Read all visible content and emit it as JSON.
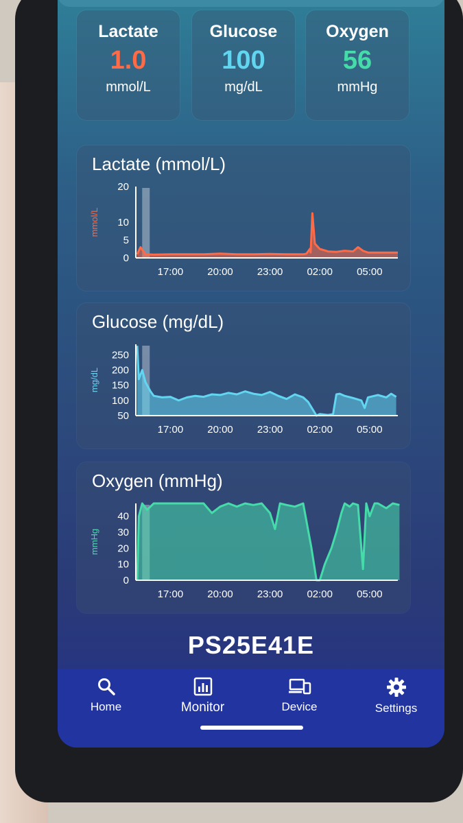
{
  "summary": [
    {
      "name": "Lactate",
      "value": "1.0",
      "unit": "mmol/L",
      "color": "#ff6a47"
    },
    {
      "name": "Glucose",
      "value": "100",
      "unit": "mg/dL",
      "color": "#62d6f0"
    },
    {
      "name": "Oxygen",
      "value": "56",
      "unit": "mmHg",
      "color": "#46dcaa"
    }
  ],
  "chart_data": [
    {
      "type": "area",
      "title": "Lactate (mmol/L)",
      "ylabel": "mmol/L",
      "ylim": [
        0,
        20
      ],
      "yticks": [
        "0",
        "5",
        "10",
        "20"
      ],
      "ytick_values": [
        0,
        5,
        10,
        20
      ],
      "xticks": [
        "17:00",
        "20:00",
        "23:00",
        "02:00",
        "05:00"
      ],
      "color": "#ff6a47",
      "label_color": "#ff6a47",
      "x_hours": [
        15.0,
        15.2,
        15.5,
        16.0,
        17.0,
        18.0,
        19.0,
        20.0,
        21.0,
        22.0,
        23.0,
        24.0,
        25.0,
        25.2,
        25.4,
        25.45,
        25.55,
        25.7,
        26.0,
        26.5,
        27.0,
        27.5,
        28.0,
        28.3,
        28.6,
        28.9,
        29.5,
        30.0,
        30.5,
        30.7
      ],
      "values": [
        1.0,
        3.0,
        1.0,
        0.9,
        1.0,
        1.0,
        1.0,
        1.2,
        1.0,
        1.0,
        1.1,
        1.0,
        1.0,
        1.2,
        2.5,
        1.5,
        12.5,
        4.0,
        2.5,
        1.8,
        1.7,
        2.0,
        1.8,
        3.0,
        2.0,
        1.5,
        1.5,
        1.5,
        1.5,
        1.5
      ]
    },
    {
      "type": "area",
      "title": "Glucose (mg/dL)",
      "ylabel": "mg/dL",
      "ylim": [
        50,
        285
      ],
      "yticks": [
        "50",
        "100",
        "150",
        "200",
        "250"
      ],
      "ytick_values": [
        50,
        100,
        150,
        200,
        250
      ],
      "xticks": [
        "17:00",
        "20:00",
        "23:00",
        "02:00",
        "05:00"
      ],
      "color": "#62d6f0",
      "label_color": "#62d6f0",
      "x_hours": [
        15.0,
        15.1,
        15.3,
        15.5,
        15.8,
        16.0,
        16.5,
        17.0,
        17.5,
        18.0,
        18.5,
        19.0,
        19.5,
        20.0,
        20.5,
        21.0,
        21.5,
        22.0,
        22.5,
        23.0,
        23.5,
        24.0,
        24.5,
        25.0,
        25.3,
        25.8,
        26.0,
        26.5,
        26.8,
        27.0,
        27.2,
        27.5,
        28.0,
        28.5,
        28.7,
        28.9,
        29.5,
        30.0,
        30.3,
        30.6
      ],
      "values": [
        280,
        170,
        200,
        160,
        130,
        115,
        110,
        112,
        100,
        110,
        115,
        112,
        120,
        118,
        125,
        120,
        130,
        122,
        118,
        128,
        115,
        105,
        120,
        110,
        95,
        50,
        55,
        52,
        55,
        120,
        122,
        115,
        108,
        100,
        75,
        110,
        118,
        110,
        122,
        112
      ]
    },
    {
      "type": "area",
      "title": "Oxygen (mmHg)",
      "ylabel": "mmHg",
      "ylim": [
        0,
        48
      ],
      "yticks": [
        "0",
        "10",
        "20",
        "30",
        "40"
      ],
      "ytick_values": [
        0,
        10,
        20,
        30,
        40
      ],
      "xticks": [
        "17:00",
        "20:00",
        "23:00",
        "02:00",
        "05:00"
      ],
      "color": "#46dcaa",
      "label_color": "#46dcaa",
      "x_hours": [
        15.0,
        15.1,
        15.3,
        15.6,
        16.0,
        17.0,
        18.0,
        19.0,
        19.5,
        20.0,
        20.5,
        21.0,
        21.5,
        22.0,
        22.5,
        23.0,
        23.3,
        23.6,
        24.0,
        24.5,
        25.0,
        25.5,
        25.8,
        26.0,
        26.3,
        26.7,
        27.0,
        27.3,
        27.5,
        27.8,
        28.0,
        28.3,
        28.6,
        28.8,
        29.0,
        29.3,
        29.5,
        30.0,
        30.4,
        30.8
      ],
      "values": [
        0,
        40,
        48,
        44,
        48,
        48,
        48,
        48,
        42,
        46,
        48,
        46,
        48,
        47,
        48,
        42,
        32,
        48,
        47,
        46,
        48,
        20,
        0,
        0,
        10,
        20,
        30,
        42,
        48,
        46,
        48,
        47,
        7,
        48,
        40,
        48,
        48,
        45,
        48,
        47
      ]
    }
  ],
  "device_id": "PS25E41E",
  "nav": [
    {
      "label": "Home",
      "icon": "search-icon"
    },
    {
      "label": "Monitor",
      "icon": "monitor-chart-icon"
    },
    {
      "label": "Device",
      "icon": "devices-icon"
    },
    {
      "label": "Settings",
      "icon": "gear-icon"
    }
  ]
}
